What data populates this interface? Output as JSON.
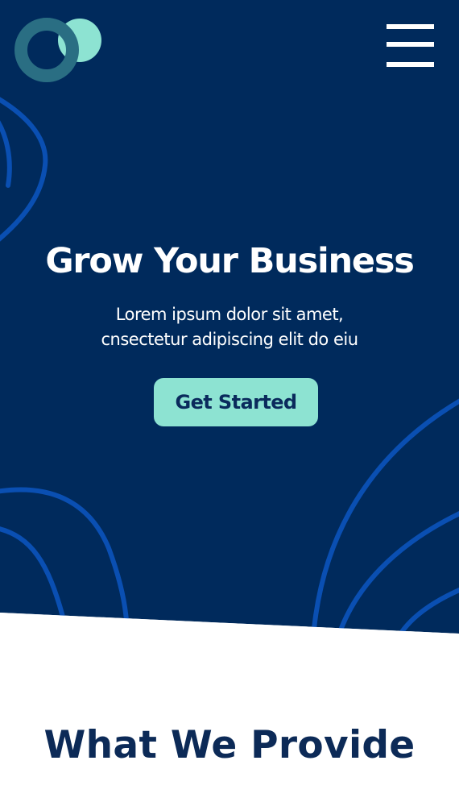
{
  "colors": {
    "hero_background": "#002a5c",
    "decorative_lines": "#0a4fb2",
    "logo_ring": "#2a6e83",
    "logo_dot": "#8de3d2",
    "cta_background": "#8de3d2",
    "cta_text": "#0a2a5c",
    "section_title": "#0c2a57"
  },
  "header": {
    "logo_icon": "two-circles-logo-icon",
    "menu_icon": "hamburger-menu-icon"
  },
  "hero": {
    "title": "Grow Your Business",
    "subtitle_line1": "Lorem ipsum dolor sit amet,",
    "subtitle_line2": "cnsectetur adipiscing elit do eiu",
    "cta_label": "Get Started"
  },
  "services": {
    "title": "What We Provide"
  }
}
